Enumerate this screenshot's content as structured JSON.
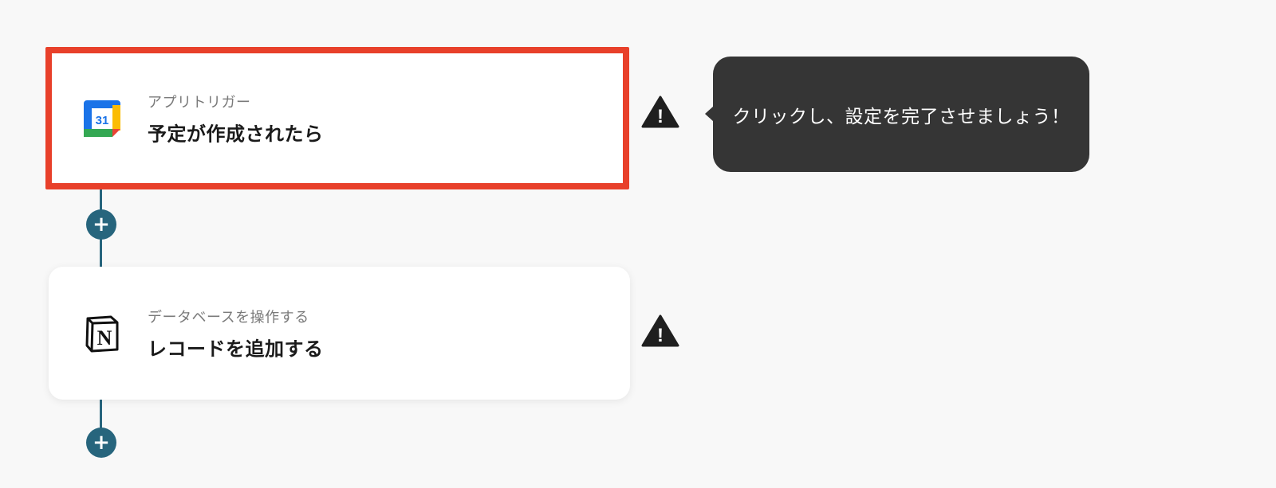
{
  "flow": {
    "steps": [
      {
        "app": "google-calendar",
        "icon": "google-calendar-icon",
        "calendar_day": "31",
        "subtitle": "アプリトリガー",
        "title": "予定が作成されたら",
        "selected": true,
        "status": "warning-icon"
      },
      {
        "app": "notion",
        "icon": "notion-icon",
        "notion_letter": "N",
        "subtitle": "データベースを操作する",
        "title": "レコードを追加する",
        "selected": false,
        "status": "warning-icon"
      }
    ],
    "add_step_icon": "plus-icon",
    "add_step_symbol": "+",
    "warning_symbol": "!"
  },
  "tooltip": {
    "text": "クリックし、設定を完了させましょう！"
  },
  "colors": {
    "background": "#f8f8f8",
    "connector": "#27657d",
    "highlight_border": "#e8402a",
    "tooltip_bg": "#353535",
    "warning": "#1f1f1f"
  }
}
